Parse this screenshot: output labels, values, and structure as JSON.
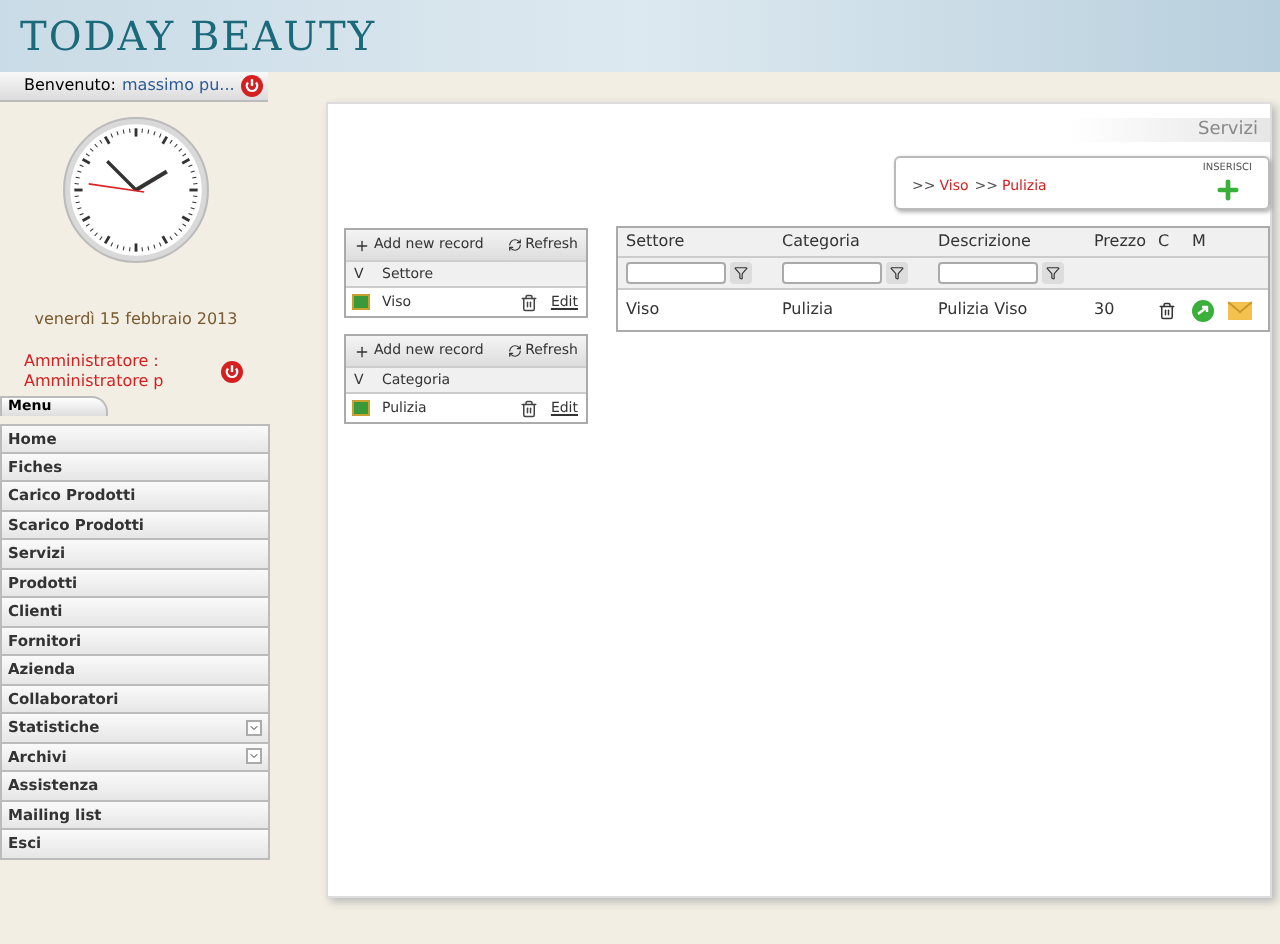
{
  "header": {
    "logo": "TODAY BEAUTY"
  },
  "welcome": {
    "label": "Benvenuto:",
    "user": "massimo pu..."
  },
  "date": "venerdì 15 febbraio 2013",
  "admin": {
    "lines": [
      "Amministratore :",
      "Amministratore p"
    ]
  },
  "menu": {
    "tab": "Menu",
    "items": [
      {
        "label": "Home",
        "expandable": false
      },
      {
        "label": "Fiches",
        "expandable": false
      },
      {
        "label": "Carico Prodotti",
        "expandable": false
      },
      {
        "label": "Scarico Prodotti",
        "expandable": false
      },
      {
        "label": "Servizi",
        "expandable": false
      },
      {
        "label": "Prodotti",
        "expandable": false
      },
      {
        "label": "Clienti",
        "expandable": false
      },
      {
        "label": "Fornitori",
        "expandable": false
      },
      {
        "label": "Azienda",
        "expandable": false
      },
      {
        "label": "Collaboratori",
        "expandable": false
      },
      {
        "label": "Statistiche",
        "expandable": true
      },
      {
        "label": "Archivi",
        "expandable": true
      },
      {
        "label": "Assistenza",
        "expandable": false
      },
      {
        "label": "Mailing list",
        "expandable": false
      },
      {
        "label": "Esci",
        "expandable": false
      }
    ]
  },
  "page_title": "Servizi",
  "breadcrumb": [
    {
      "sep": ">>",
      "label": "Viso"
    },
    {
      "sep": ">>",
      "label": "Pulizia"
    }
  ],
  "insert_label": "INSERISCI",
  "small_grids": [
    {
      "add": "Add new record",
      "refresh": "Refresh",
      "columns": [
        "V",
        "Settore"
      ],
      "rows": [
        {
          "name": "Viso",
          "edit": "Edit"
        }
      ]
    },
    {
      "add": "Add new record",
      "refresh": "Refresh",
      "columns": [
        "V",
        "Categoria"
      ],
      "rows": [
        {
          "name": "Pulizia",
          "edit": "Edit"
        }
      ]
    }
  ],
  "services_grid": {
    "columns": [
      {
        "label": "Settore",
        "filter": true
      },
      {
        "label": "Categoria",
        "filter": true
      },
      {
        "label": "Descrizione",
        "filter": true
      },
      {
        "label": "Prezzo",
        "filter": false
      },
      {
        "label": "C",
        "filter": false
      },
      {
        "label": "M",
        "filter": false
      }
    ],
    "rows": [
      {
        "settore": "Viso",
        "categoria": "Pulizia",
        "descrizione": "Pulizia Viso",
        "prezzo": "30"
      }
    ]
  }
}
